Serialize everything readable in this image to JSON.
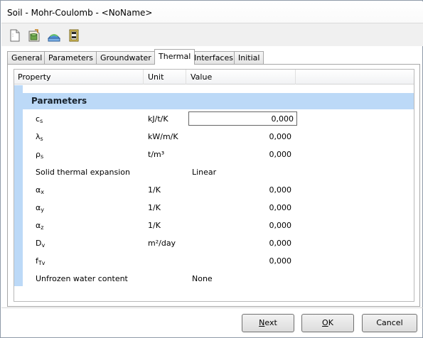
{
  "window": {
    "title": "Soil - Mohr-Coulomb - <NoName>"
  },
  "toolbar": {
    "icons": [
      "new-document-icon",
      "open-database-icon",
      "global-database-icon",
      "material-clipboard-icon"
    ]
  },
  "tabs": [
    {
      "label": "General",
      "active": false
    },
    {
      "label": "Parameters",
      "active": false
    },
    {
      "label": "Groundwater",
      "active": false
    },
    {
      "label": "Thermal",
      "active": true
    },
    {
      "label": "Interfaces",
      "active": false
    },
    {
      "label": "Initial",
      "active": false
    }
  ],
  "grid": {
    "headers": {
      "property": "Property",
      "unit": "Unit",
      "value": "Value"
    },
    "group_label": "Parameters",
    "rows": [
      {
        "sym": "c",
        "sub": "s",
        "unit": "kJ/t/K",
        "value": "0,000"
      },
      {
        "sym": "λ",
        "sub": "s",
        "unit": "kW/m/K",
        "value": "0,000"
      },
      {
        "sym": "ρ",
        "sub": "s",
        "unit": "t/m³",
        "value": "0,000"
      },
      {
        "label": "Solid thermal expansion",
        "unit": "",
        "value": "Linear"
      },
      {
        "sym": "α",
        "sub": "x",
        "unit": "1/K",
        "value": "0,000"
      },
      {
        "sym": "α",
        "sub": "y",
        "unit": "1/K",
        "value": "0,000"
      },
      {
        "sym": "α",
        "sub": "z",
        "unit": "1/K",
        "value": "0,000"
      },
      {
        "sym": "D",
        "sub": "v",
        "unit": "m²/day",
        "value": "0,000"
      },
      {
        "sym": "f",
        "sub": "Tv",
        "unit": "",
        "value": "0,000"
      },
      {
        "label": "Unfrozen water content",
        "unit": "",
        "value": "None"
      }
    ]
  },
  "buttons": {
    "next_prefix": "",
    "next_mnemonic": "N",
    "next_rest": "ext",
    "ok_prefix": "",
    "ok_mnemonic": "O",
    "ok_rest": "K",
    "cancel": "Cancel"
  },
  "colors": {
    "group_bg": "#bcd9f7",
    "border": "#a7a7a7"
  }
}
